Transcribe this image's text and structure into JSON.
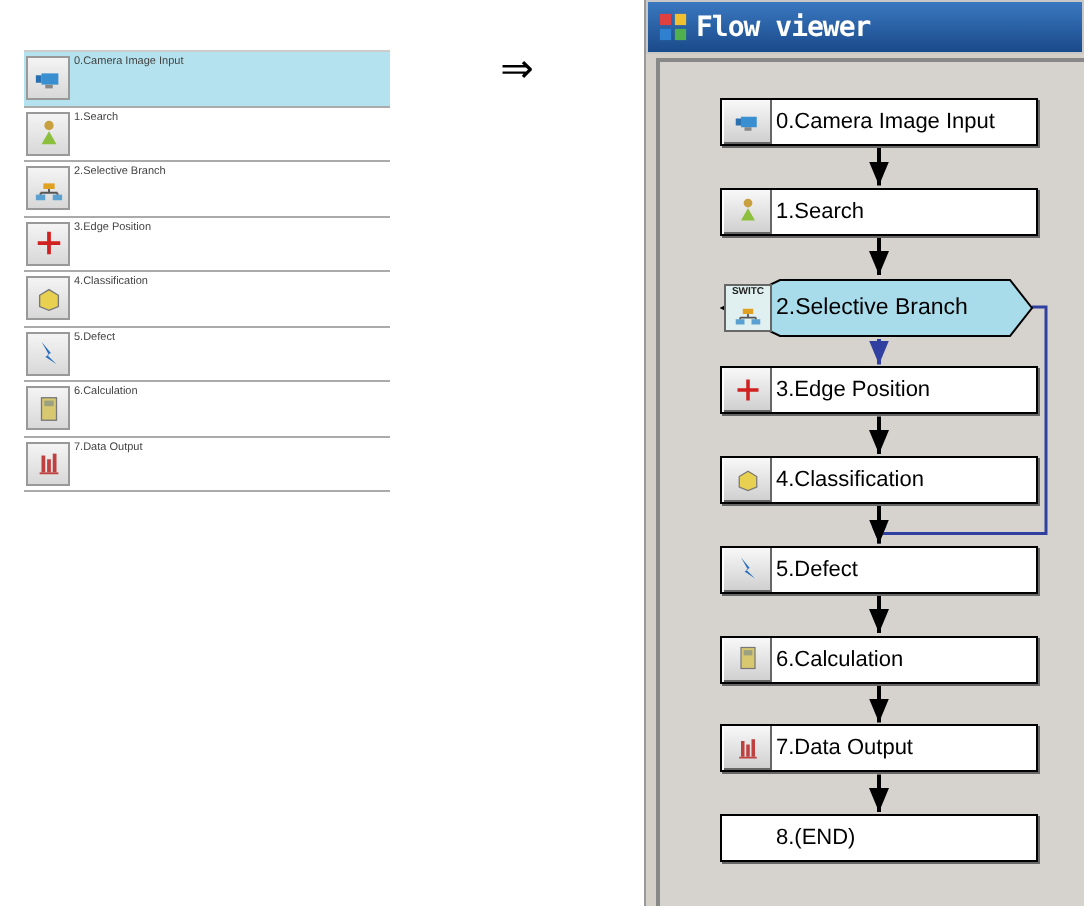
{
  "step_list": [
    {
      "label": "0.Camera Image Input",
      "selected": true
    },
    {
      "label": "1.Search",
      "selected": false
    },
    {
      "label": "2.Selective Branch",
      "selected": false
    },
    {
      "label": "3.Edge Position",
      "selected": false
    },
    {
      "label": "4.Classification",
      "selected": false
    },
    {
      "label": "5.Defect",
      "selected": false
    },
    {
      "label": "6.Calculation",
      "selected": false
    },
    {
      "label": "7.Data Output",
      "selected": false
    }
  ],
  "arrow_symbol": "⇒",
  "window": {
    "title": "Flow viewer"
  },
  "flow_nodes": [
    {
      "label": "0.Camera Image Input",
      "kind": "step"
    },
    {
      "label": "1.Search",
      "kind": "step"
    },
    {
      "label": "2.Selective Branch",
      "kind": "branch",
      "icon_text": "SWITC"
    },
    {
      "label": "3.Edge Position",
      "kind": "step"
    },
    {
      "label": "4.Classification",
      "kind": "step"
    },
    {
      "label": "5.Defect",
      "kind": "step"
    },
    {
      "label": "6.Calculation",
      "kind": "step"
    },
    {
      "label": "7.Data Output",
      "kind": "step"
    },
    {
      "label": "8.(END)",
      "kind": "end"
    }
  ]
}
